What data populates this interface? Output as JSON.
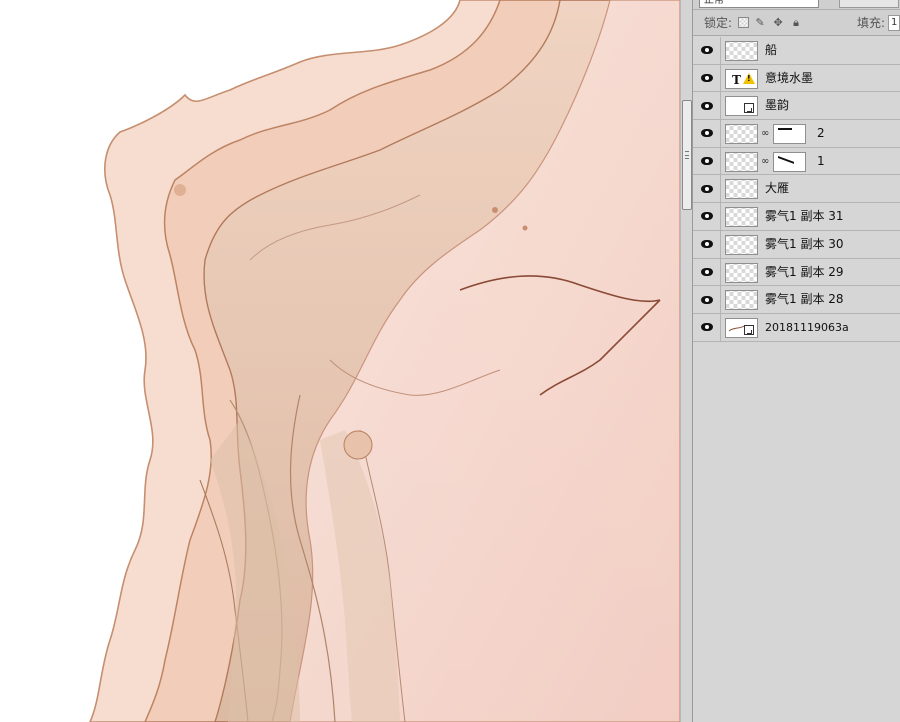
{
  "app": "Photoshop",
  "canvas": {
    "description_colors": {
      "paper": "#ffffff",
      "wash_light": "#f8e2d8",
      "wash_mid": "#ecc3ae",
      "wash_pink": "#f3cfc6",
      "edge_dark": "#b07a5a",
      "edge_deep": "#8a5038",
      "sediment": "#c9a890"
    }
  },
  "layers_panel": {
    "blend_mode": "正常",
    "lock_label": "锁定:",
    "fill_label": "填充:",
    "fill_value": "1",
    "layers": [
      {
        "name": "船",
        "type": "normal",
        "visible": true
      },
      {
        "name": "意境水墨",
        "type": "text-warning",
        "visible": true
      },
      {
        "name": "墨韵",
        "type": "smart-object",
        "visible": true
      },
      {
        "name": "2",
        "type": "masked",
        "visible": true
      },
      {
        "name": "1",
        "type": "masked",
        "visible": true
      },
      {
        "name": "大雁",
        "type": "normal",
        "visible": true
      },
      {
        "name": "雾气1 副本 31",
        "type": "normal",
        "visible": true
      },
      {
        "name": "雾气1 副本 30",
        "type": "normal",
        "visible": true
      },
      {
        "name": "雾气1 副本 29",
        "type": "normal",
        "visible": true
      },
      {
        "name": "雾气1 副本 28",
        "type": "normal",
        "visible": true
      },
      {
        "name": "20181119063a",
        "type": "smart-object-image",
        "visible": true
      }
    ]
  }
}
